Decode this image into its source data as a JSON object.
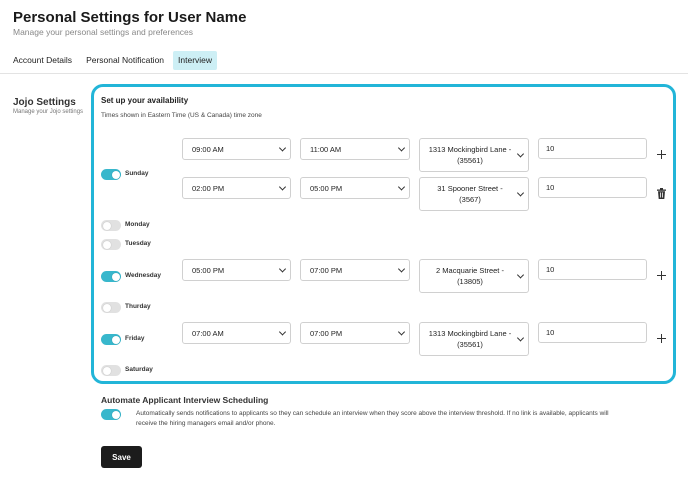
{
  "header": {
    "title": "Personal Settings for User Name",
    "subtitle": "Manage your personal settings and preferences"
  },
  "tabs": [
    {
      "label": "Account Details",
      "active": false
    },
    {
      "label": "Personal Notification",
      "active": false
    },
    {
      "label": "Interview",
      "active": true
    }
  ],
  "sidebar": {
    "title": "Jojo Settings",
    "subtitle": "Manage your Jojo settings"
  },
  "availability": {
    "title": "Set up your availability",
    "timezone_note": "Times shown in Eastern Time (US & Canada) time zone",
    "days": [
      {
        "name": "Sunday",
        "enabled": true,
        "slots": [
          {
            "start": "09:00 AM",
            "end": "11:00 AM",
            "location": "1313 Mockingbird Lane - (35561)",
            "value": "10"
          },
          {
            "start": "02:00 PM",
            "end": "05:00 PM",
            "location": "31 Spooner Street - (3567)",
            "value": "10"
          }
        ]
      },
      {
        "name": "Monday",
        "enabled": false,
        "slots": []
      },
      {
        "name": "Tuesday",
        "enabled": false,
        "slots": []
      },
      {
        "name": "Wednesday",
        "enabled": true,
        "slots": [
          {
            "start": "05:00 PM",
            "end": "07:00 PM",
            "location": "2 Macquarie Street - (13805)",
            "value": "10"
          }
        ]
      },
      {
        "name": "Thurday",
        "enabled": false,
        "slots": []
      },
      {
        "name": "Friday",
        "enabled": true,
        "slots": [
          {
            "start": "07:00 AM",
            "end": "07:00 PM",
            "location": "1313 Mockingbird Lane - (35561)",
            "value": "10"
          }
        ]
      },
      {
        "name": "Saturday",
        "enabled": false,
        "slots": []
      }
    ]
  },
  "automate": {
    "title": "Automate Applicant Interview Scheduling",
    "enabled": true,
    "description": "Automatically sends notifications to applicants so they can schedule an interview when they score above the interview threshold. If no link is available, applicants will receive the hiring managers email and/or phone."
  },
  "actions": {
    "save_label": "Save"
  },
  "colors": {
    "accent": "#22b5d8",
    "toggle_on": "#38b7cc",
    "active_tab": "#cdeff5",
    "save_button": "#1c1c1c"
  },
  "icons": {
    "add": "plus-icon",
    "remove": "trash-icon",
    "dropdown": "chevron-down-icon"
  }
}
